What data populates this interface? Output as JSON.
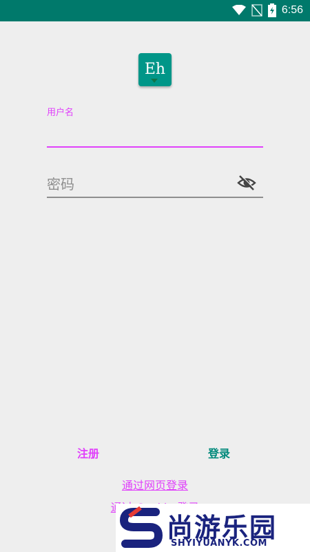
{
  "status_bar": {
    "time": "6:56",
    "icons": [
      "wifi-icon",
      "signal-off-icon",
      "battery-charging-icon"
    ]
  },
  "logo": {
    "text": "Eh"
  },
  "username": {
    "label": "用户名",
    "value": ""
  },
  "password": {
    "placeholder": "密码",
    "toggle_icon": "eye-off-icon"
  },
  "actions": {
    "register": "注册",
    "login": "登录"
  },
  "links": {
    "web_login": "通过网页登录",
    "cookie_login": "通过 Cookie 登录"
  },
  "watermark": {
    "cn": "尚游乐园",
    "en": "SHYIYUANYK.COM"
  },
  "colors": {
    "primary": "#00796b",
    "accent": "#e040fb",
    "login": "#00897b",
    "background": "#eeeeee"
  }
}
